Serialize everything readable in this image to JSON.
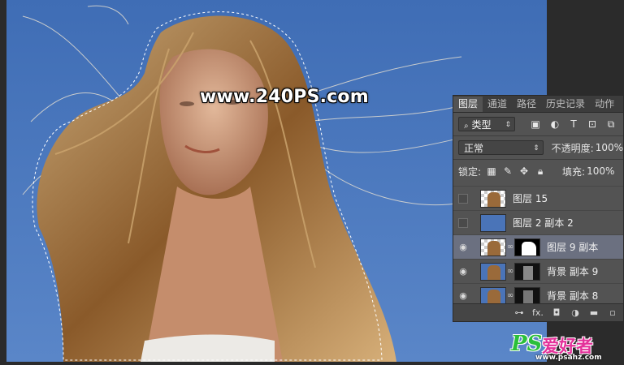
{
  "watermark": "www.240PS.com",
  "panel": {
    "tabs": [
      "图层",
      "通道",
      "路径",
      "历史记录",
      "动作"
    ],
    "active_tab": "图层",
    "filter": {
      "label": "类型",
      "icon": "search-icon"
    },
    "blend_mode": "正常",
    "opacity_label": "不透明度:",
    "opacity_value": "100%",
    "lock_label": "锁定:",
    "fill_label": "填充:",
    "fill_value": "100%",
    "layers": [
      {
        "name": "图层 15",
        "visible": false,
        "has_mask": false
      },
      {
        "name": "图层 2 副本 2",
        "visible": false,
        "has_mask": false
      },
      {
        "name": "图层 9 副本",
        "visible": true,
        "has_mask": true,
        "selected": true
      },
      {
        "name": "背景 副本 9",
        "visible": true,
        "has_mask": true
      },
      {
        "name": "背景 副本 8",
        "visible": true,
        "has_mask": true
      }
    ],
    "bottom_icons": [
      "link-icon",
      "fx-icon",
      "mask-icon",
      "adjustment-icon",
      "group-folder-icon",
      "new-layer-icon"
    ],
    "fx_label": "fx."
  },
  "logo": {
    "brand": "PS",
    "text": "爱好者",
    "url": "www.psahz.com"
  },
  "colors": {
    "sky": "#4a74b8",
    "panel": "#535353",
    "selected": "#6b7080"
  }
}
